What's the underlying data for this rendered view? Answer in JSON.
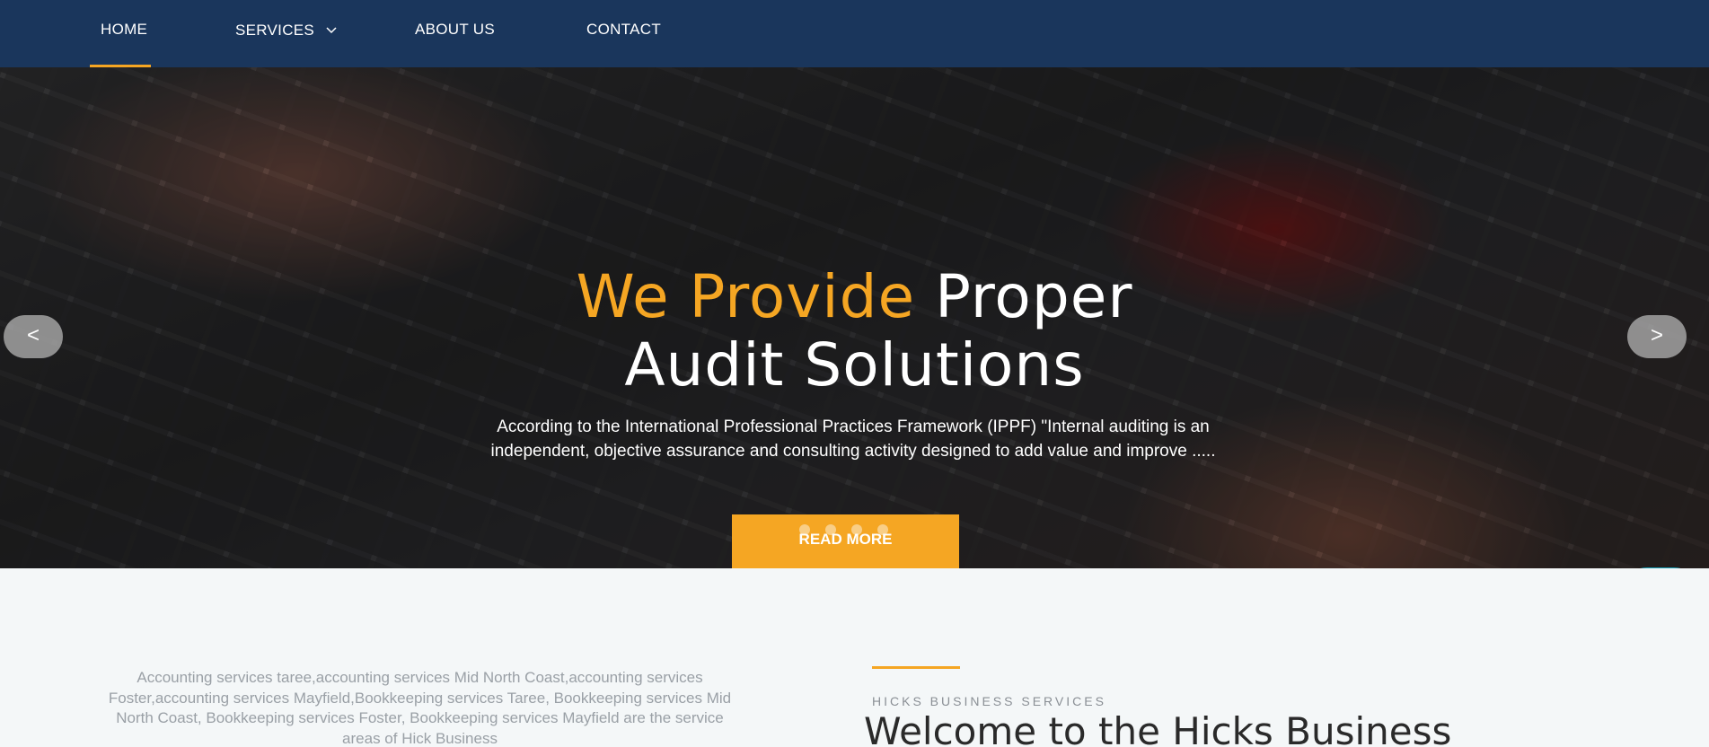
{
  "nav": {
    "items": [
      {
        "label": "HOME"
      },
      {
        "label": "SERVICES"
      },
      {
        "label": "ABOUT US"
      },
      {
        "label": "CONTACT"
      }
    ]
  },
  "hero": {
    "title_accent": "We Provide",
    "title_rest": "Proper",
    "title_line2": "Audit Solutions",
    "text": "According to the International Professional Practices Framework (IPPF) \"Internal auditing is an independent, objective assurance and consulting activity designed to add value and improve .....",
    "button_label": "READ MORE",
    "prev_arrow": "<",
    "next_arrow": ">",
    "slide_count": 4
  },
  "about": {
    "service_areas_text": "Accounting services taree,accounting services Mid North Coast,accounting services Foster,accounting services Mayfield,Bookkeeping services Taree, Bookkeeping services Mid North Coast, Bookkeeping services Foster, Bookkeeping services Mayfield are the service areas of Hick Business",
    "eyebrow": "HICKS BUSINESS SERVICES",
    "heading": "Welcome to the Hicks Business"
  },
  "colors": {
    "nav_bg": "#1a365c",
    "accent": "#f5a623",
    "chat": "#17a2b8"
  },
  "icons": {
    "services_dropdown": "chevron-down-icon",
    "chat": "chat-bubble-icon"
  }
}
